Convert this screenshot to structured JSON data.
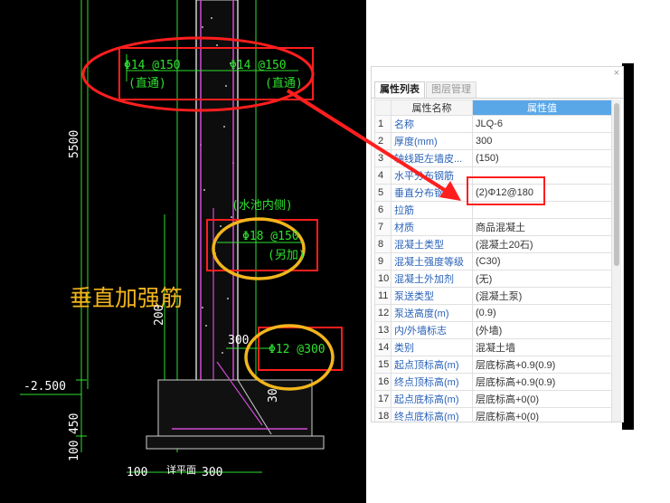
{
  "cad": {
    "top_left_rebar": "Φ14 @150",
    "top_left_note": "(直通)",
    "top_right_rebar": "Φ14 @150",
    "top_right_note": "(直通)",
    "height_dim": "5500",
    "water_side_note": "(水池内侧)",
    "mid_rebar": "Φ18 @150",
    "mid_note": "(另加)",
    "overlay_label": "垂直加强筋",
    "low_dim": "200",
    "dim_300_a": "300",
    "low_rebar": "Φ12 @300",
    "dim_30": "30",
    "elevation": "-2.500",
    "dim_450": "450",
    "dim_100_left": "100",
    "bottom_dim_100": "100",
    "bottom_detail": "详平面",
    "bottom_dim_300": "300"
  },
  "panel": {
    "close_glyph": "×",
    "tabs": [
      {
        "label": "属性列表"
      },
      {
        "label": "图层管理"
      }
    ],
    "headers": {
      "name": "属性名称",
      "value": "属性值"
    },
    "rows": [
      {
        "idx": "1",
        "name": "名称",
        "value": "JLQ-6"
      },
      {
        "idx": "2",
        "name": "厚度(mm)",
        "value": "300"
      },
      {
        "idx": "3",
        "name": "轴线距左墙皮...",
        "value": "(150)"
      },
      {
        "idx": "4",
        "name": "水平分布钢筋",
        "value": ""
      },
      {
        "idx": "5",
        "name": "垂直分布钢筋",
        "value": "(2)Φ12@180"
      },
      {
        "idx": "6",
        "name": "拉筋",
        "value": ""
      },
      {
        "idx": "7",
        "name": "材质",
        "value": "商品混凝土"
      },
      {
        "idx": "8",
        "name": "混凝土类型",
        "value": "(混凝土20石)"
      },
      {
        "idx": "9",
        "name": "混凝土强度等级",
        "value": "(C30)"
      },
      {
        "idx": "10",
        "name": "混凝土外加剂",
        "value": "(无)"
      },
      {
        "idx": "11",
        "name": "泵送类型",
        "value": "(混凝土泵)"
      },
      {
        "idx": "12",
        "name": "泵送高度(m)",
        "value": "(0.9)"
      },
      {
        "idx": "13",
        "name": "内/外墙标志",
        "value": "(外墙)"
      },
      {
        "idx": "14",
        "name": "类别",
        "value": "混凝土墙"
      },
      {
        "idx": "15",
        "name": "起点顶标高(m)",
        "value": "层底标高+0.9(0.9)"
      },
      {
        "idx": "16",
        "name": "终点顶标高(m)",
        "value": "层底标高+0.9(0.9)"
      },
      {
        "idx": "17",
        "name": "起点底标高(m)",
        "value": "层底标高+0(0)"
      },
      {
        "idx": "18",
        "name": "终点底标高(m)",
        "value": "层底标高+0(0)"
      }
    ]
  },
  "colors": {
    "annotation_red": "#ff1e1e",
    "annotation_orange": "#f2b51c",
    "header_blue": "#5aa7e8",
    "cad_green": "#2ee12e"
  }
}
